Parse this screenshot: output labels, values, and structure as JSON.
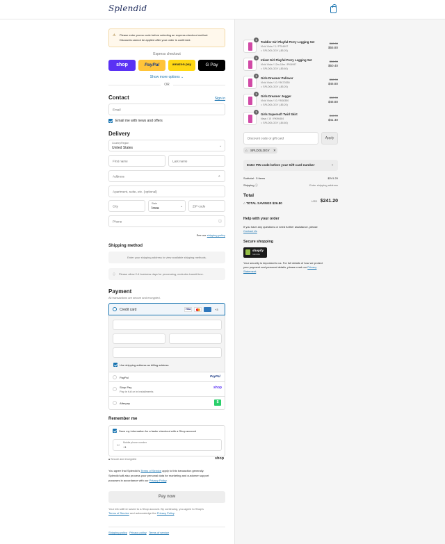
{
  "header": {
    "logo": "Splendid",
    "cart_icon": "bag-icon"
  },
  "notice": {
    "text1": "Please enter promo code before selecting an express checkout method.",
    "text2": "Discounts cannot be applied after your order is confirmed."
  },
  "express": {
    "label": "Express checkout",
    "shop": "shop",
    "paypal": "PayPal",
    "amazon": "amazon pay",
    "gpay": "G Pay",
    "more": "Show more options ⌄",
    "or": "OR"
  },
  "contact": {
    "title": "Contact",
    "signin": "Sign in",
    "email_ph": "Email",
    "news": "Email me with news and offers"
  },
  "delivery": {
    "title": "Delivery",
    "country_label": "Country/Region",
    "country": "United States",
    "first": "First name",
    "last": "Last name",
    "address": "Address",
    "apt": "Apartment, suite, etc. (optional)",
    "city": "City",
    "state_label": "State",
    "state": "Iowa",
    "zip": "ZIP code",
    "phone": "Phone",
    "policy_pre": "See our",
    "policy_link": "shipping policy"
  },
  "shipping": {
    "title": "Shipping method",
    "placeholder": "Enter your shipping address to view available shipping methods.",
    "note": "Please allow 2-4 business days for processing, excludes transit time."
  },
  "payment": {
    "title": "Payment",
    "subtitle": "All transactions are secure and encrypted.",
    "credit": "Credit card",
    "more_cards": "+3",
    "billing": "Use shipping address as billing address",
    "paypal": "PayPal",
    "shoppay": "Shop Pay",
    "shoppay_sub": "Pay in full or in installments",
    "afterpay": "Afterpay"
  },
  "remember": {
    "title": "Remember me",
    "save": "Save my information for a faster checkout with a Shop account",
    "mobile_label": "Mobile phone number",
    "mobile": "+1",
    "secure": "Secure and encrypted",
    "shop": "shop"
  },
  "legal": {
    "l1_a": "You agree that Splendid's",
    "tos": "Terms of Service",
    "l1_b": "apply to this transaction generally.",
    "l2": "Splendid will also process your personal data for marketing and customer support",
    "l3_a": "purposes in accordance with our",
    "privacy": "Privacy Policy",
    "period": "."
  },
  "pay": {
    "button": "Pay now",
    "info1": "Your info will be saved to a Shop account. By continuing, you agree to Shop's",
    "info_tos": "Terms of Service",
    "info_and": "and acknowledge the",
    "info_privacy": "Privacy Policy"
  },
  "footer": {
    "shipping": "Shipping policy",
    "privacy": "Privacy policy",
    "terms": "Terms of service"
  },
  "items": [
    {
      "qty": "1",
      "name": "Toddler Girl Playful Perry Legging Set",
      "variant": "Vivid Viola / 3 / PT04997",
      "code": "SPLDOLOGY (-$5.20)",
      "old": "$62.00",
      "price": "$55.80"
    },
    {
      "qty": "1",
      "name": "Infant Girl Playful Perry Legging Set",
      "variant": "Vivid Viola / 12m-18m / PI04997",
      "code": "SPLDOLOGY (-$5.60)",
      "old": "$56.00",
      "price": "$50.40"
    },
    {
      "qty": "1",
      "name": "Girls Dreamer Pullover",
      "variant": "Vivid Viola / 10 / RK70350",
      "code": "SPLDOLOGY (-$5.20)",
      "old": "$52.00",
      "price": "$46.80"
    },
    {
      "qty": "1",
      "name": "Girls Dreamer Jogger",
      "variant": "Vivid Viola / 10 / RI08350",
      "code": "SPLDOLOGY (-$5.20)",
      "old": "$52.00",
      "price": "$46.80"
    },
    {
      "qty": "1",
      "name": "Girls Supersoft Twirl Skirt",
      "variant": "Navy / 10 / RK96484",
      "code": "SPLDOLOGY (-$4.60)",
      "old": "$46.00",
      "price": "$41.40"
    }
  ],
  "summary": {
    "discount_ph": "Discount code or gift card",
    "apply": "Apply",
    "tag": "SPLDOLOGY",
    "pin": "Enter PIN code before your Gift card number",
    "subtotal_label": "Subtotal · 5 items",
    "subtotal": "$241.20",
    "shipping_label": "Shipping",
    "shipping": "Enter shipping address",
    "total_label": "Total",
    "currency": "USD",
    "total": "$241.20",
    "savings": "TOTAL SAVINGS $26.80"
  },
  "help": {
    "title": "Help with your order",
    "text": "If you have any questions or need further assistance, please",
    "link": "Contact Us"
  },
  "secure": {
    "title": "Secure shopping",
    "badge": "shopify",
    "badge_sub": "SECURE",
    "text1": "Your security is important to us. For full details of how we protect",
    "text2": "your payment and personal details, please read our",
    "link1": "Privacy",
    "link2": "Statement"
  },
  "colors": {
    "accent": "#1773b0",
    "shop": "#5a31f4",
    "paypal": "#ffc439",
    "amazon": "#ffd814",
    "gpay": "#000000",
    "notice_bg": "#fff8ec",
    "afterpay": "#2bcf6b",
    "pink": "#d14aa6"
  }
}
